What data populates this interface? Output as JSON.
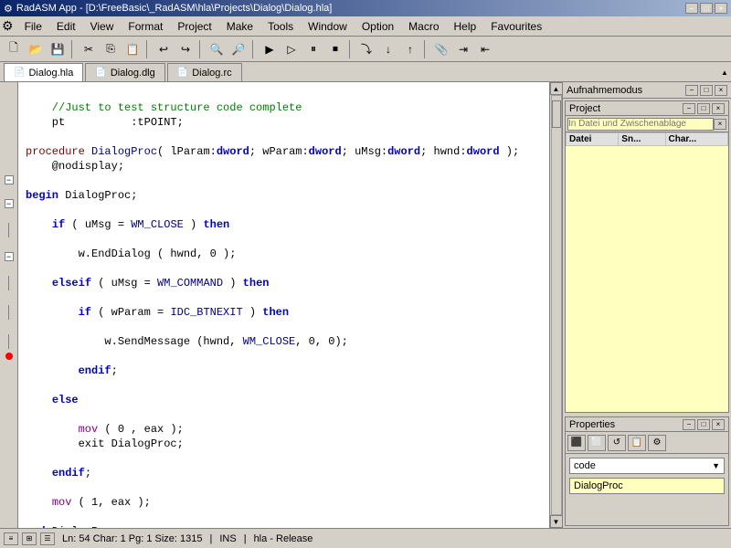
{
  "titlebar": {
    "title": "RadASM App - [D:\\FreeBasic\\_RadASM\\hla\\Projects\\Dialog\\Dialog.hla]",
    "app_icon": "radasm-icon",
    "minimize": "−",
    "maximize": "□",
    "close": "×",
    "win_minimize": "−",
    "win_maximize": "□",
    "win_close": "×"
  },
  "menubar": {
    "items": [
      {
        "label": "File",
        "id": "menu-file"
      },
      {
        "label": "Edit",
        "id": "menu-edit"
      },
      {
        "label": "View",
        "id": "menu-view"
      },
      {
        "label": "Format",
        "id": "menu-format"
      },
      {
        "label": "Project",
        "id": "menu-project"
      },
      {
        "label": "Make",
        "id": "menu-make"
      },
      {
        "label": "Tools",
        "id": "menu-tools"
      },
      {
        "label": "Window",
        "id": "menu-window"
      },
      {
        "label": "Option",
        "id": "menu-option"
      },
      {
        "label": "Macro",
        "id": "menu-macro"
      },
      {
        "label": "Help",
        "id": "menu-help"
      },
      {
        "label": "Favourites",
        "id": "menu-favourites"
      }
    ]
  },
  "tabs": [
    {
      "label": "Dialog.hla",
      "active": true
    },
    {
      "label": "Dialog.dlg",
      "active": false
    },
    {
      "label": "Dialog.rc",
      "active": false
    }
  ],
  "aufnahme": {
    "label": "Aufnahmemodus"
  },
  "project": {
    "header": "Project",
    "search_placeholder": "In Datei und Zwischenablage"
  },
  "properties": {
    "header": "Properties",
    "dropdown_value": "code",
    "value": "DialogProc"
  },
  "statusbar": {
    "position": "Ln: 54  Char: 1 Pg: 1 Size: 1315",
    "mode": "INS",
    "lang": "hla - Release"
  },
  "code": {
    "lines": [
      {
        "indent": "    ",
        "text": "//Just to test structure code complete",
        "type": "comment"
      },
      {
        "indent": "    ",
        "text": "pt          :tPOINT;",
        "type": "normal"
      },
      {
        "indent": "",
        "text": "",
        "type": "normal"
      },
      {
        "indent": "",
        "text": "procedure DialogProc( lParam:dword; wParam:dword; uMsg:dword; hwnd:dword );",
        "type": "proc"
      },
      {
        "indent": "    ",
        "text": "@nodisplay;",
        "type": "normal"
      },
      {
        "indent": "",
        "text": "",
        "type": "normal"
      },
      {
        "indent": "",
        "text": "begin DialogProc;",
        "type": "keyword"
      },
      {
        "indent": "",
        "text": "",
        "type": "normal"
      },
      {
        "indent": "    ",
        "text": "if ( uMsg = WM_CLOSE ) then",
        "type": "if"
      },
      {
        "indent": "",
        "text": "",
        "type": "normal"
      },
      {
        "indent": "        ",
        "text": "w.EndDialog ( hwnd, 0 );",
        "type": "normal"
      },
      {
        "indent": "",
        "text": "",
        "type": "normal"
      },
      {
        "indent": "    ",
        "text": "elseif ( uMsg = WM_COMMAND ) then",
        "type": "if"
      },
      {
        "indent": "",
        "text": "",
        "type": "normal"
      },
      {
        "indent": "        ",
        "text": "if ( wParam = IDC_BTNEXIT ) then",
        "type": "if"
      },
      {
        "indent": "",
        "text": "",
        "type": "normal"
      },
      {
        "indent": "            ",
        "text": "w.SendMessage (hwnd, WM_CLOSE, 0, 0);",
        "type": "normal"
      },
      {
        "indent": "",
        "text": "",
        "type": "normal"
      },
      {
        "indent": "        ",
        "text": "endif;",
        "type": "keyword"
      },
      {
        "indent": "",
        "text": "",
        "type": "normal"
      },
      {
        "indent": "    ",
        "text": "else",
        "type": "keyword"
      },
      {
        "indent": "",
        "text": "",
        "type": "normal"
      },
      {
        "indent": "        ",
        "text": "mov ( 0 , eax );",
        "type": "normal"
      },
      {
        "indent": "        ",
        "text": "exit DialogProc;",
        "type": "normal"
      },
      {
        "indent": "",
        "text": "",
        "type": "normal"
      },
      {
        "indent": "    ",
        "text": "endif;",
        "type": "keyword"
      },
      {
        "indent": "",
        "text": "",
        "type": "normal"
      },
      {
        "indent": "    ",
        "text": "mov ( 1, eax );",
        "type": "normal"
      },
      {
        "indent": "",
        "text": "",
        "type": "normal"
      },
      {
        "indent": "",
        "text": "end DialogProc;",
        "type": "keyword"
      }
    ]
  }
}
